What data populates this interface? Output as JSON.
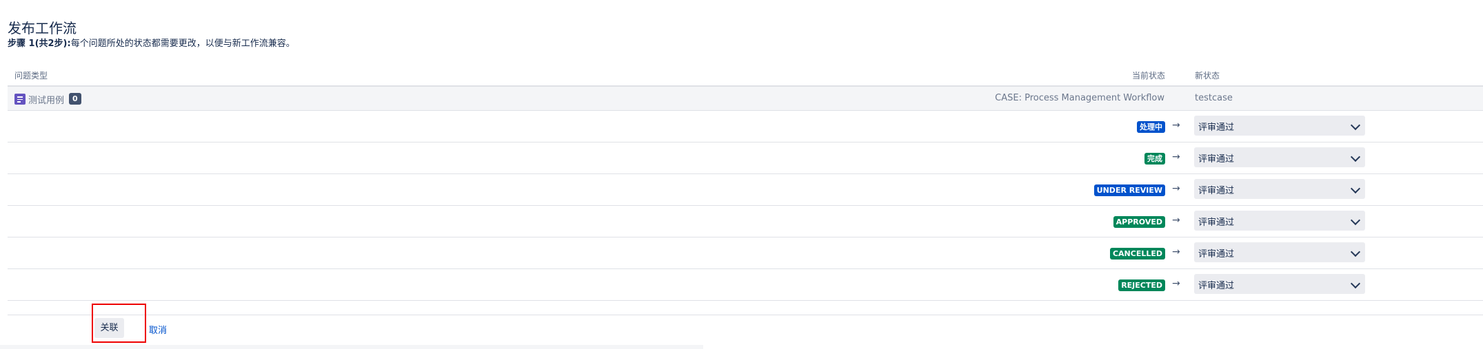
{
  "page": {
    "title": "发布工作流",
    "step_label": "步骤 1(共2步):",
    "step_text": "每个问题所处的状态都需要更改，以便与新工作流兼容。"
  },
  "table": {
    "headers": {
      "issue_type": "问题类型",
      "current_status": "当前状态",
      "new_status": "新状态"
    },
    "issue_type": {
      "name": "测试用例",
      "count": "0",
      "icon": "task-icon",
      "workflow": "CASE: Process Management Workflow",
      "target_workflow": "testcase"
    },
    "rows": [
      {
        "status": "处理中",
        "color": "#0052cc",
        "arrow": "→",
        "new_status": "评审通过"
      },
      {
        "status": "完成",
        "color": "#00875a",
        "arrow": "→",
        "new_status": "评审通过"
      },
      {
        "status": "UNDER REVIEW",
        "color": "#0052cc",
        "arrow": "→",
        "new_status": "评审通过"
      },
      {
        "status": "APPROVED",
        "color": "#00875a",
        "arrow": "→",
        "new_status": "评审通过"
      },
      {
        "status": "CANCELLED",
        "color": "#00875a",
        "arrow": "→",
        "new_status": "评审通过"
      },
      {
        "status": "REJECTED",
        "color": "#00875a",
        "arrow": "→",
        "new_status": "评审通过"
      }
    ]
  },
  "actions": {
    "associate": "关联",
    "cancel": "取消"
  },
  "colors": {
    "link": "#0052cc",
    "highlight_box": "#ee0000"
  }
}
